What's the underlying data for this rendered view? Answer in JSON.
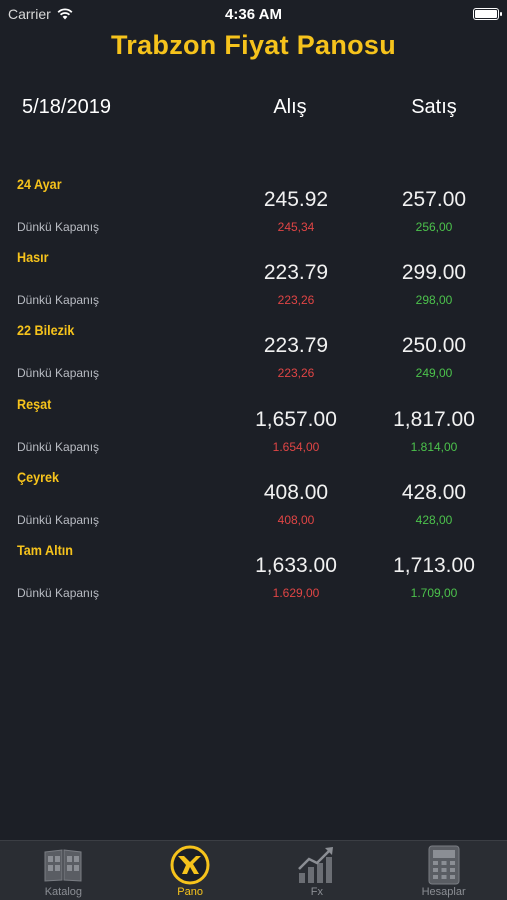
{
  "status_bar": {
    "carrier": "Carrier",
    "time": "4:36 AM"
  },
  "app_title": "Trabzon Fiyat Panosu",
  "header": {
    "date": "5/18/2019",
    "alis": "Alış",
    "satis": "Satış"
  },
  "rows": [
    {
      "name": "24 Ayar",
      "sub": "Dünkü Kapanış",
      "alis": "245.92",
      "satis": "257.00",
      "alis_close": "245,34",
      "satis_close": "256,00"
    },
    {
      "name": "Hasır",
      "sub": "Dünkü Kapanış",
      "alis": "223.79",
      "satis": "299.00",
      "alis_close": "223,26",
      "satis_close": "298,00"
    },
    {
      "name": "22 Bilezik",
      "sub": "Dünkü Kapanış",
      "alis": "223.79",
      "satis": "250.00",
      "alis_close": "223,26",
      "satis_close": "249,00"
    },
    {
      "name": "Reşat",
      "sub": "Dünkü Kapanış",
      "alis": "1,657.00",
      "satis": "1,817.00",
      "alis_close": "1.654,00",
      "satis_close": "1.814,00"
    },
    {
      "name": "Çeyrek",
      "sub": "Dünkü Kapanış",
      "alis": "408.00",
      "satis": "428.00",
      "alis_close": "408,00",
      "satis_close": "428,00"
    },
    {
      "name": "Tam Altın",
      "sub": "Dünkü Kapanış",
      "alis": "1,633.00",
      "satis": "1,713.00",
      "alis_close": "1.629,00",
      "satis_close": "1.709,00"
    }
  ],
  "tabs": [
    {
      "label": "Katalog",
      "icon": "catalog-icon",
      "active": false
    },
    {
      "label": "Pano",
      "icon": "pano-logo-icon",
      "active": true
    },
    {
      "label": "Fx",
      "icon": "chart-icon",
      "active": false
    },
    {
      "label": "Hesaplar",
      "icon": "calculator-icon",
      "active": false
    }
  ],
  "colors": {
    "accent": "#f6c31c",
    "background": "#1c1f26",
    "down": "#e04545",
    "up": "#4cc24c"
  }
}
